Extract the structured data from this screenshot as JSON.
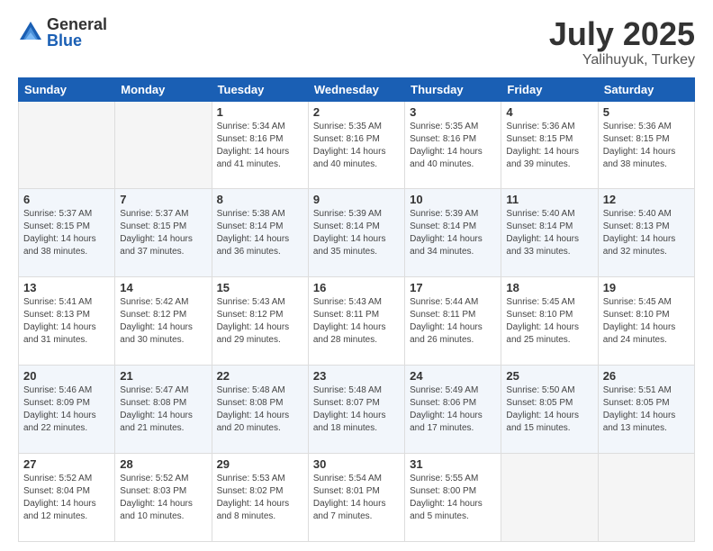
{
  "logo": {
    "general": "General",
    "blue": "Blue"
  },
  "header": {
    "month": "July 2025",
    "location": "Yalihuyuk, Turkey"
  },
  "weekdays": [
    "Sunday",
    "Monday",
    "Tuesday",
    "Wednesday",
    "Thursday",
    "Friday",
    "Saturday"
  ],
  "weeks": [
    [
      {
        "day": "",
        "sunrise": "",
        "sunset": "",
        "daylight": ""
      },
      {
        "day": "",
        "sunrise": "",
        "sunset": "",
        "daylight": ""
      },
      {
        "day": "1",
        "sunrise": "Sunrise: 5:34 AM",
        "sunset": "Sunset: 8:16 PM",
        "daylight": "Daylight: 14 hours and 41 minutes."
      },
      {
        "day": "2",
        "sunrise": "Sunrise: 5:35 AM",
        "sunset": "Sunset: 8:16 PM",
        "daylight": "Daylight: 14 hours and 40 minutes."
      },
      {
        "day": "3",
        "sunrise": "Sunrise: 5:35 AM",
        "sunset": "Sunset: 8:16 PM",
        "daylight": "Daylight: 14 hours and 40 minutes."
      },
      {
        "day": "4",
        "sunrise": "Sunrise: 5:36 AM",
        "sunset": "Sunset: 8:15 PM",
        "daylight": "Daylight: 14 hours and 39 minutes."
      },
      {
        "day": "5",
        "sunrise": "Sunrise: 5:36 AM",
        "sunset": "Sunset: 8:15 PM",
        "daylight": "Daylight: 14 hours and 38 minutes."
      }
    ],
    [
      {
        "day": "6",
        "sunrise": "Sunrise: 5:37 AM",
        "sunset": "Sunset: 8:15 PM",
        "daylight": "Daylight: 14 hours and 38 minutes."
      },
      {
        "day": "7",
        "sunrise": "Sunrise: 5:37 AM",
        "sunset": "Sunset: 8:15 PM",
        "daylight": "Daylight: 14 hours and 37 minutes."
      },
      {
        "day": "8",
        "sunrise": "Sunrise: 5:38 AM",
        "sunset": "Sunset: 8:14 PM",
        "daylight": "Daylight: 14 hours and 36 minutes."
      },
      {
        "day": "9",
        "sunrise": "Sunrise: 5:39 AM",
        "sunset": "Sunset: 8:14 PM",
        "daylight": "Daylight: 14 hours and 35 minutes."
      },
      {
        "day": "10",
        "sunrise": "Sunrise: 5:39 AM",
        "sunset": "Sunset: 8:14 PM",
        "daylight": "Daylight: 14 hours and 34 minutes."
      },
      {
        "day": "11",
        "sunrise": "Sunrise: 5:40 AM",
        "sunset": "Sunset: 8:14 PM",
        "daylight": "Daylight: 14 hours and 33 minutes."
      },
      {
        "day": "12",
        "sunrise": "Sunrise: 5:40 AM",
        "sunset": "Sunset: 8:13 PM",
        "daylight": "Daylight: 14 hours and 32 minutes."
      }
    ],
    [
      {
        "day": "13",
        "sunrise": "Sunrise: 5:41 AM",
        "sunset": "Sunset: 8:13 PM",
        "daylight": "Daylight: 14 hours and 31 minutes."
      },
      {
        "day": "14",
        "sunrise": "Sunrise: 5:42 AM",
        "sunset": "Sunset: 8:12 PM",
        "daylight": "Daylight: 14 hours and 30 minutes."
      },
      {
        "day": "15",
        "sunrise": "Sunrise: 5:43 AM",
        "sunset": "Sunset: 8:12 PM",
        "daylight": "Daylight: 14 hours and 29 minutes."
      },
      {
        "day": "16",
        "sunrise": "Sunrise: 5:43 AM",
        "sunset": "Sunset: 8:11 PM",
        "daylight": "Daylight: 14 hours and 28 minutes."
      },
      {
        "day": "17",
        "sunrise": "Sunrise: 5:44 AM",
        "sunset": "Sunset: 8:11 PM",
        "daylight": "Daylight: 14 hours and 26 minutes."
      },
      {
        "day": "18",
        "sunrise": "Sunrise: 5:45 AM",
        "sunset": "Sunset: 8:10 PM",
        "daylight": "Daylight: 14 hours and 25 minutes."
      },
      {
        "day": "19",
        "sunrise": "Sunrise: 5:45 AM",
        "sunset": "Sunset: 8:10 PM",
        "daylight": "Daylight: 14 hours and 24 minutes."
      }
    ],
    [
      {
        "day": "20",
        "sunrise": "Sunrise: 5:46 AM",
        "sunset": "Sunset: 8:09 PM",
        "daylight": "Daylight: 14 hours and 22 minutes."
      },
      {
        "day": "21",
        "sunrise": "Sunrise: 5:47 AM",
        "sunset": "Sunset: 8:08 PM",
        "daylight": "Daylight: 14 hours and 21 minutes."
      },
      {
        "day": "22",
        "sunrise": "Sunrise: 5:48 AM",
        "sunset": "Sunset: 8:08 PM",
        "daylight": "Daylight: 14 hours and 20 minutes."
      },
      {
        "day": "23",
        "sunrise": "Sunrise: 5:48 AM",
        "sunset": "Sunset: 8:07 PM",
        "daylight": "Daylight: 14 hours and 18 minutes."
      },
      {
        "day": "24",
        "sunrise": "Sunrise: 5:49 AM",
        "sunset": "Sunset: 8:06 PM",
        "daylight": "Daylight: 14 hours and 17 minutes."
      },
      {
        "day": "25",
        "sunrise": "Sunrise: 5:50 AM",
        "sunset": "Sunset: 8:05 PM",
        "daylight": "Daylight: 14 hours and 15 minutes."
      },
      {
        "day": "26",
        "sunrise": "Sunrise: 5:51 AM",
        "sunset": "Sunset: 8:05 PM",
        "daylight": "Daylight: 14 hours and 13 minutes."
      }
    ],
    [
      {
        "day": "27",
        "sunrise": "Sunrise: 5:52 AM",
        "sunset": "Sunset: 8:04 PM",
        "daylight": "Daylight: 14 hours and 12 minutes."
      },
      {
        "day": "28",
        "sunrise": "Sunrise: 5:52 AM",
        "sunset": "Sunset: 8:03 PM",
        "daylight": "Daylight: 14 hours and 10 minutes."
      },
      {
        "day": "29",
        "sunrise": "Sunrise: 5:53 AM",
        "sunset": "Sunset: 8:02 PM",
        "daylight": "Daylight: 14 hours and 8 minutes."
      },
      {
        "day": "30",
        "sunrise": "Sunrise: 5:54 AM",
        "sunset": "Sunset: 8:01 PM",
        "daylight": "Daylight: 14 hours and 7 minutes."
      },
      {
        "day": "31",
        "sunrise": "Sunrise: 5:55 AM",
        "sunset": "Sunset: 8:00 PM",
        "daylight": "Daylight: 14 hours and 5 minutes."
      },
      {
        "day": "",
        "sunrise": "",
        "sunset": "",
        "daylight": ""
      },
      {
        "day": "",
        "sunrise": "",
        "sunset": "",
        "daylight": ""
      }
    ]
  ]
}
